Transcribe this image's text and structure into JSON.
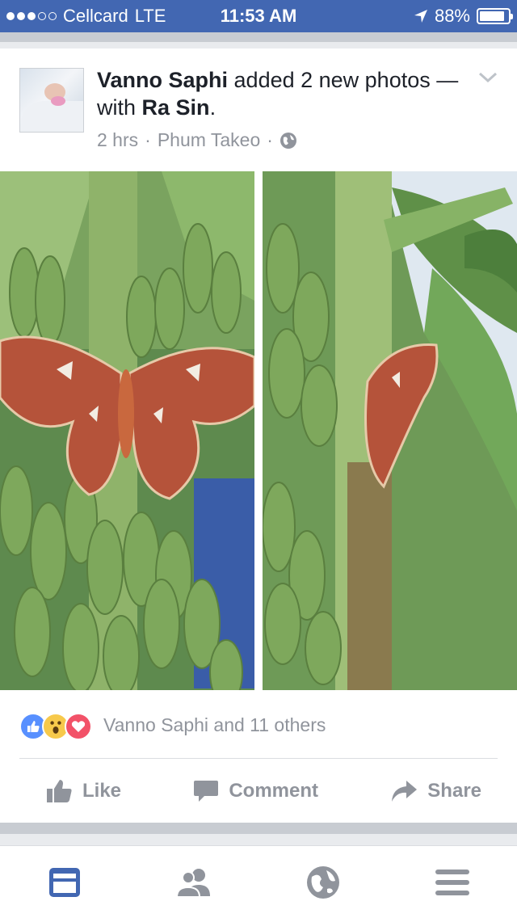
{
  "status_bar": {
    "carrier": "Cellcard",
    "network": "LTE",
    "time": "11:53 AM",
    "battery": "88%",
    "battery_level": 0.88,
    "signal_bars_on": 3,
    "signal_bars_total": 5
  },
  "post": {
    "author": "Vanno Saphi",
    "action_text": " added 2 new photos — with ",
    "tagged": "Ra Sin",
    "tail": ".",
    "time": "2 hrs",
    "location": "Phum Takeo",
    "separator": "·",
    "privacy_icon": "globe-icon",
    "menu_icon": "chevron-down-icon"
  },
  "reactions": {
    "icons": [
      "like-icon",
      "wow-icon",
      "love-icon"
    ],
    "text": "Vanno Saphi and 11 others"
  },
  "actions": {
    "like": "Like",
    "comment": "Comment",
    "share": "Share"
  },
  "tab_bar": {
    "items": [
      "news-feed-icon",
      "friends-icon",
      "globe-icon",
      "menu-icon"
    ],
    "active": "news-feed-icon"
  },
  "colors": {
    "brand": "#4267b2",
    "secondary_text": "#90949c",
    "like_blue": "#5890ff",
    "love_red": "#f25268",
    "wow_yellow": "#f7c94b"
  }
}
